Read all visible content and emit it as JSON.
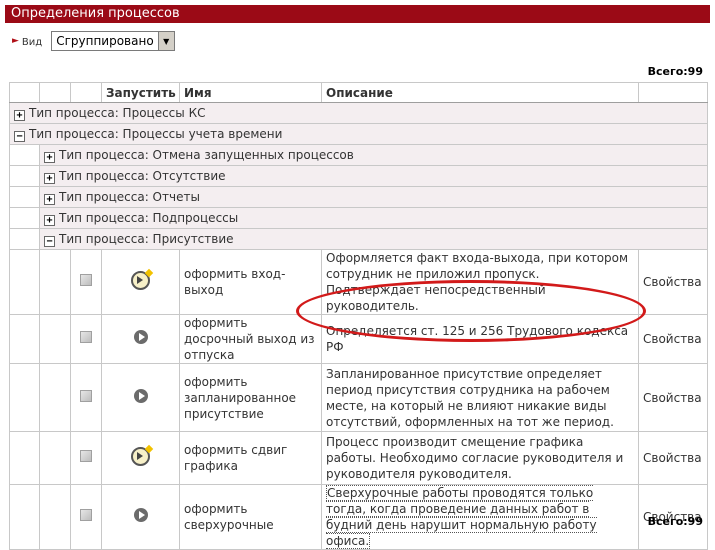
{
  "page": {
    "title": "Определения процессов"
  },
  "toolbar": {
    "view_label": "Вид",
    "view_select_value": "Сгруппировано"
  },
  "totals": {
    "top": "Всего:99",
    "bottom": "Всего:99"
  },
  "table": {
    "headers": {
      "launch": "Запустить",
      "name": "Имя",
      "description": "Описание"
    },
    "groups": [
      {
        "label": "Тип процесса: Процессы КС",
        "toggle": "+"
      },
      {
        "label": "Тип процесса: Процессы учета времени",
        "toggle": "−"
      }
    ],
    "subgroups": [
      {
        "label": "Тип процесса: Отмена запущенных процессов",
        "toggle": "+"
      },
      {
        "label": "Тип процесса: Отсутствие",
        "toggle": "+"
      },
      {
        "label": "Тип процесса: Отчеты",
        "toggle": "+"
      },
      {
        "label": "Тип процесса: Подпроцессы",
        "toggle": "+"
      },
      {
        "label": "Тип процесса: Присутствие",
        "toggle": "−"
      }
    ],
    "rows": [
      {
        "icon": "clock-run-icon",
        "name": "оформить вход-выход",
        "description": "Оформляется факт входа-выхода, при котором сотрудник не приложил пропуск. Подтверждает непосредственный руководитель.",
        "action": "Свойства"
      },
      {
        "icon": "play-icon",
        "name": "оформить досрочный выход из отпуска",
        "description": "Определяется ст. 125 и 256 Трудового кодекса РФ",
        "action": "Свойства"
      },
      {
        "icon": "play-icon",
        "name": "оформить запланированное присутствие",
        "description": "Запланированное присутствие определяет период присутствия сотрудника на рабочем месте, на который не влияют никакие виды отсутствий, оформленных на тот же период.",
        "action": "Свойства"
      },
      {
        "icon": "clock-run-icon",
        "name": "оформить сдвиг графика",
        "description": "Процесс производит смещение графика работы. Необходимо согласие руководителя и руководителя руководителя.",
        "action": "Свойства"
      },
      {
        "icon": "play-icon",
        "name": "оформить сверхурочные",
        "description": "Сверхурочные работы проводятся только тогда, когда проведение данных работ в будний день нарушит нормальную работу офиса.",
        "action": "Свойства"
      }
    ]
  },
  "colors": {
    "title_bar": "#9b0a16",
    "group_row": "#f4eef0",
    "highlight_oval": "#d21a1a"
  }
}
